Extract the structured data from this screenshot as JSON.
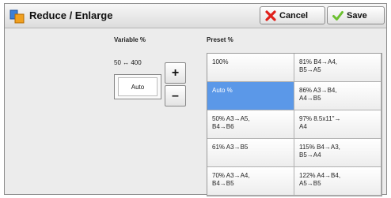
{
  "window": {
    "title": "Reduce / Enlarge"
  },
  "toolbar": {
    "cancel_label": "Cancel",
    "save_label": "Save"
  },
  "variable": {
    "heading": "Variable %",
    "range": "50 ↔ 400",
    "value": "Auto",
    "plus": "+",
    "minus": "–"
  },
  "preset": {
    "heading": "Preset %",
    "items": [
      "100%",
      "81% B4→A4,\nB5→A5",
      "Auto %",
      "86% A3→B4,\nA4→B5",
      "50% A3→A5,\nB4→B6",
      "97% 8.5x11\"→\nA4",
      "61% A3→B5",
      "115% B4→A3,\nB5→A4",
      "70% A3→A4,\nB4→B5",
      "122% A4→B4,\nA5→B5"
    ],
    "selected": "Auto %"
  },
  "colors": {
    "selected_bg": "#5b98e8",
    "cancel_icon": "#e0201b",
    "save_icon": "#6cc030"
  }
}
